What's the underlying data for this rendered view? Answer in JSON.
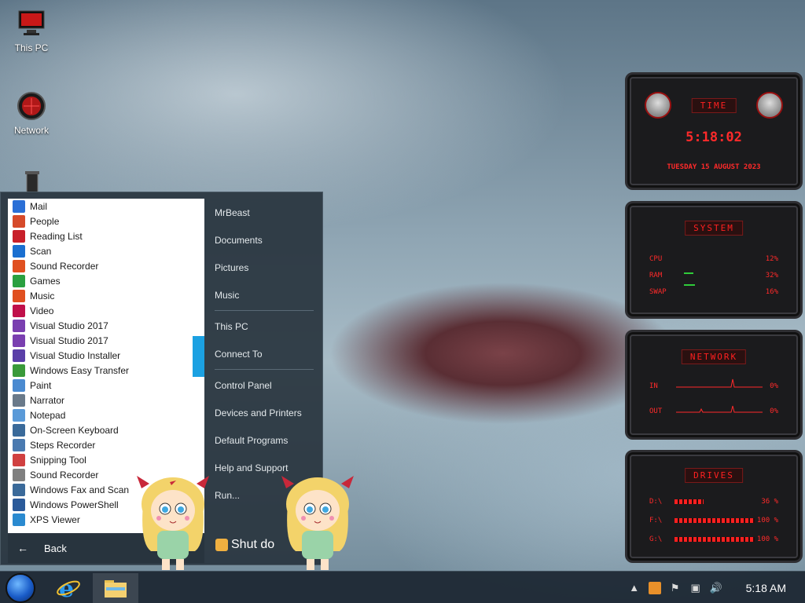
{
  "desktop": {
    "icons": [
      {
        "label": "This PC"
      },
      {
        "label": "Network"
      }
    ]
  },
  "start_menu": {
    "programs": [
      {
        "label": "Mail",
        "color": "#2a6fd6"
      },
      {
        "label": "People",
        "color": "#d64a2a"
      },
      {
        "label": "Reading List",
        "color": "#c8202a"
      },
      {
        "label": "Scan",
        "color": "#1a6fd0"
      },
      {
        "label": "Sound Recorder",
        "color": "#e05020"
      },
      {
        "label": "Games",
        "color": "#2aa040"
      },
      {
        "label": "Music",
        "color": "#e05020"
      },
      {
        "label": "Video",
        "color": "#c0104a"
      },
      {
        "label": "Visual Studio 2017",
        "color": "#7a3fb0"
      },
      {
        "label": "Visual Studio 2017",
        "color": "#7a3fb0"
      },
      {
        "label": "Visual Studio Installer",
        "color": "#5a3fa8"
      },
      {
        "label": "Windows Easy Transfer",
        "color": "#3a9a3a"
      },
      {
        "label": "Paint",
        "color": "#4a8ad0"
      },
      {
        "label": "Narrator",
        "color": "#6a7a8a"
      },
      {
        "label": "Notepad",
        "color": "#5a9ad8"
      },
      {
        "label": "On-Screen Keyboard",
        "color": "#3a6a9a"
      },
      {
        "label": "Steps Recorder",
        "color": "#4a7ab0"
      },
      {
        "label": "Snipping Tool",
        "color": "#d04040"
      },
      {
        "label": "Sound Recorder",
        "color": "#808080"
      },
      {
        "label": "Windows Fax and Scan",
        "color": "#3a6a9a"
      },
      {
        "label": "Windows PowerShell",
        "color": "#2a5a9a"
      },
      {
        "label": "XPS Viewer",
        "color": "#2a8ad0"
      }
    ],
    "back_label": "Back",
    "right_pane": {
      "group1": [
        "MrBeast",
        "Documents",
        "Pictures",
        "Music"
      ],
      "group2": [
        "This PC",
        "Connect To"
      ],
      "group3": [
        "Control Panel",
        "Devices and Printers",
        "Default Programs",
        "Help and Support",
        "Run..."
      ]
    },
    "shutdown_label": "Shut do"
  },
  "gadgets": {
    "time": {
      "title": "TIME",
      "clock": "5:18:02",
      "date": "TUESDAY 15 AUGUST 2023"
    },
    "system": {
      "title": "SYSTEM",
      "rows": [
        {
          "label": "CPU",
          "value": "12%"
        },
        {
          "label": "RAM",
          "value": "32%"
        },
        {
          "label": "SWAP",
          "value": "16%"
        }
      ]
    },
    "network": {
      "title": "NETWORK",
      "rows": [
        {
          "label": "IN",
          "value": "0%"
        },
        {
          "label": "OUT",
          "value": "0%"
        }
      ]
    },
    "drives": {
      "title": "DRIVES",
      "rows": [
        {
          "label": "D:\\",
          "value": "36 %",
          "fill": 0.36
        },
        {
          "label": "F:\\",
          "value": "100 %",
          "fill": 1.0
        },
        {
          "label": "G:\\",
          "value": "100 %",
          "fill": 1.0
        }
      ]
    }
  },
  "taskbar": {
    "clock": "5:18 AM"
  }
}
